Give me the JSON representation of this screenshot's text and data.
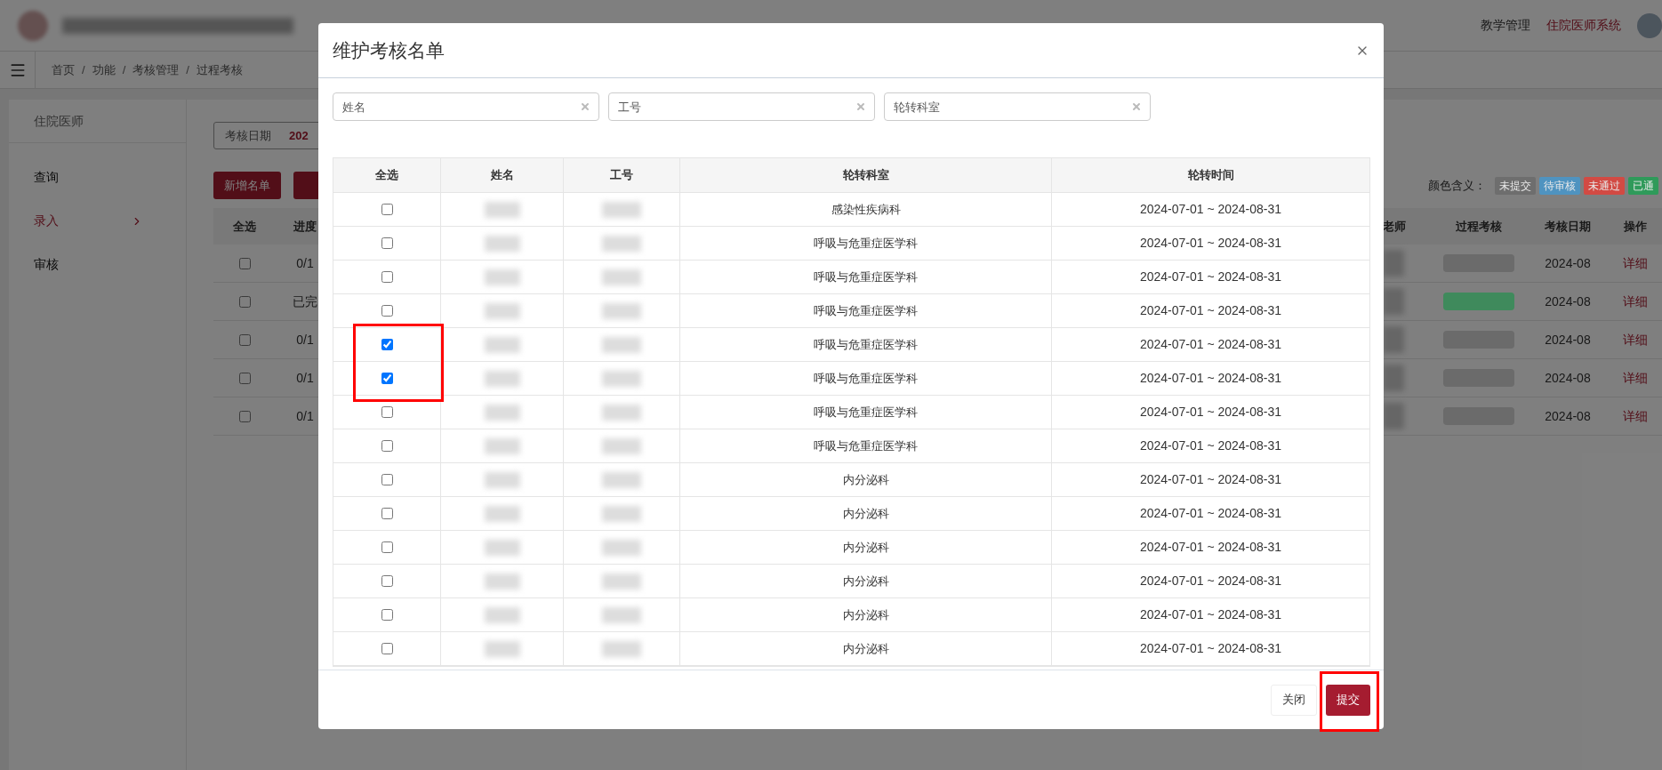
{
  "header": {
    "nav": [
      {
        "label": "教学管理",
        "selected": false
      },
      {
        "label": "住院医师系统",
        "selected": true
      }
    ]
  },
  "breadcrumb": [
    {
      "kind": "link",
      "text": "首页"
    },
    {
      "kind": "separator",
      "text": "/"
    },
    {
      "kind": "link",
      "text": "功能"
    },
    {
      "kind": "separator",
      "text": "/"
    },
    {
      "kind": "link",
      "text": "考核管理"
    },
    {
      "kind": "separator",
      "text": "/"
    },
    {
      "kind": "link",
      "text": "过程考核"
    }
  ],
  "sidebar": {
    "title": "住院医师",
    "items": [
      {
        "label": "查询",
        "selected": false,
        "expandable": false
      },
      {
        "label": "录入",
        "selected": true,
        "expandable": true
      },
      {
        "label": "审核",
        "selected": false,
        "expandable": false
      }
    ]
  },
  "filter": {
    "label": "考核日期",
    "value": "202"
  },
  "toolbar": {
    "buttons": [
      "新增名单"
    ]
  },
  "legend": {
    "label": "颜色含义：",
    "items": [
      {
        "label": "未提交",
        "color": "#6e6e6e"
      },
      {
        "label": "待审核",
        "color": "#4f93c0"
      },
      {
        "label": "未通过",
        "color": "#d24a43"
      },
      {
        "label": "已通",
        "color": "#2f9a5a"
      }
    ]
  },
  "list_table": {
    "columns_left": [
      "全选",
      "进度"
    ],
    "columns_right": [
      "老师",
      "过程考核",
      "考核日期",
      "操作"
    ],
    "rows": [
      {
        "checked": false,
        "progress": "0/1",
        "color": "#6b6b6b",
        "date": "2024-08",
        "action": "详细"
      },
      {
        "checked": false,
        "progress": "已完",
        "color": "#3f8a5c",
        "date": "2024-08",
        "action": "详细"
      },
      {
        "checked": false,
        "progress": "0/1",
        "color": "#6b6b6b",
        "date": "2024-08",
        "action": "详细"
      },
      {
        "checked": false,
        "progress": "0/1",
        "color": "#6b6b6b",
        "date": "2024-08",
        "action": "详细"
      },
      {
        "checked": false,
        "progress": "0/1",
        "color": "#6b6b6b",
        "date": "2024-08",
        "action": "详细"
      }
    ]
  },
  "modal": {
    "title": "维护考核名单",
    "filters": [
      {
        "placeholder": "姓名"
      },
      {
        "placeholder": "工号"
      },
      {
        "placeholder": "轮转科室"
      }
    ],
    "columns": [
      "全选",
      "姓名",
      "工号",
      "轮转科室",
      "轮转时间"
    ],
    "rows": [
      {
        "checked": false,
        "department": "感染性疾病科",
        "period": "2024-07-01 ~ 2024-08-31"
      },
      {
        "checked": false,
        "department": "呼吸与危重症医学科",
        "period": "2024-07-01 ~ 2024-08-31"
      },
      {
        "checked": false,
        "department": "呼吸与危重症医学科",
        "period": "2024-07-01 ~ 2024-08-31"
      },
      {
        "checked": false,
        "department": "呼吸与危重症医学科",
        "period": "2024-07-01 ~ 2024-08-31"
      },
      {
        "checked": true,
        "department": "呼吸与危重症医学科",
        "period": "2024-07-01 ~ 2024-08-31"
      },
      {
        "checked": true,
        "department": "呼吸与危重症医学科",
        "period": "2024-07-01 ~ 2024-08-31"
      },
      {
        "checked": false,
        "department": "呼吸与危重症医学科",
        "period": "2024-07-01 ~ 2024-08-31"
      },
      {
        "checked": false,
        "department": "呼吸与危重症医学科",
        "period": "2024-07-01 ~ 2024-08-31"
      },
      {
        "checked": false,
        "department": "内分泌科",
        "period": "2024-07-01 ~ 2024-08-31"
      },
      {
        "checked": false,
        "department": "内分泌科",
        "period": "2024-07-01 ~ 2024-08-31"
      },
      {
        "checked": false,
        "department": "内分泌科",
        "period": "2024-07-01 ~ 2024-08-31"
      },
      {
        "checked": false,
        "department": "内分泌科",
        "period": "2024-07-01 ~ 2024-08-31"
      },
      {
        "checked": false,
        "department": "内分泌科",
        "period": "2024-07-01 ~ 2024-08-31"
      },
      {
        "checked": false,
        "department": "内分泌科",
        "period": "2024-07-01 ~ 2024-08-31"
      }
    ],
    "buttons": [
      {
        "label": "关闭",
        "kind": "secondary"
      },
      {
        "label": "提交",
        "kind": "primary"
      }
    ]
  }
}
